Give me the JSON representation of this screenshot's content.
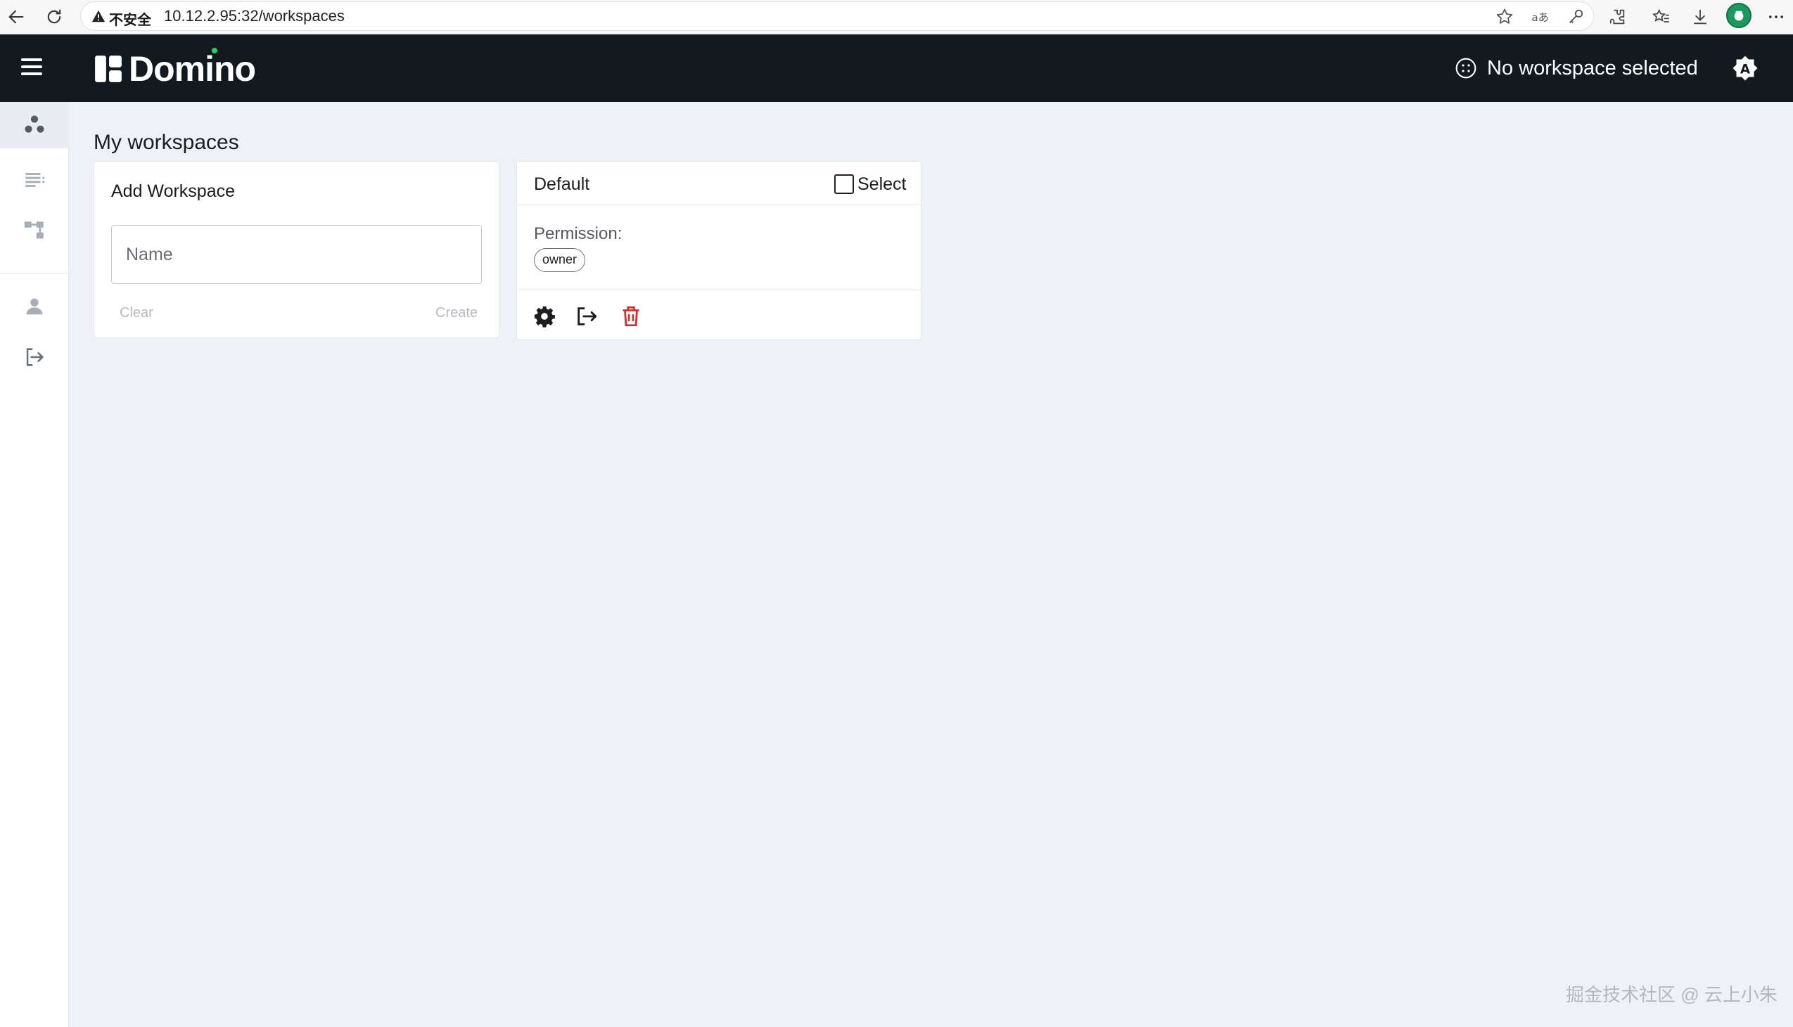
{
  "browser": {
    "insecure_label": "不安全",
    "url": "10.12.2.95:32/workspaces"
  },
  "header": {
    "logo_text": "Domino",
    "workspace_status": "No workspace selected"
  },
  "sidebar": {
    "items": [
      {
        "icon": "workspaces-icon",
        "active": true
      },
      {
        "icon": "list-icon",
        "active": false
      },
      {
        "icon": "hierarchy-icon",
        "active": false
      },
      {
        "icon": "user-icon",
        "active": false
      },
      {
        "icon": "logout-icon",
        "active": false
      }
    ]
  },
  "main": {
    "title": "My workspaces",
    "add_card": {
      "title": "Add Workspace",
      "name_placeholder": "Name",
      "clear_label": "Clear",
      "create_label": "Create"
    },
    "workspaces": [
      {
        "name": "Default",
        "select_label": "Select",
        "selected": false,
        "permission_label": "Permission:",
        "permission": "owner"
      }
    ]
  },
  "watermark": "掘金技术社区 @ 云上小朱",
  "colors": {
    "header_bg": "#121a1f",
    "page_bg": "#eef2f6",
    "accent_green": "#1fd168",
    "delete_red": "#d32f2f"
  }
}
